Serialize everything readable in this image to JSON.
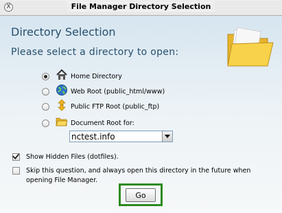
{
  "window": {
    "title": "File Manager Directory Selection",
    "close_glyph": "X"
  },
  "dialog": {
    "heading": "Directory Selection",
    "subheading": "Please select a directory to open:",
    "options": [
      {
        "label": "Home Directory",
        "icon": "house-icon",
        "selected": true
      },
      {
        "label": "Web Root (public_html/www)",
        "icon": "globe-icon",
        "selected": false
      },
      {
        "label": "Public FTP Root (public_ftp)",
        "icon": "ftp-arrows-icon",
        "selected": false
      },
      {
        "label": "Document Root for:",
        "icon": "folder-icon",
        "selected": false
      }
    ],
    "domain_select": {
      "value": "nctest.info"
    },
    "show_hidden": {
      "label": "Show Hidden Files (dotfiles).",
      "checked": true
    },
    "skip_question": {
      "label": "Skip this question, and always open this directory in the future when opening File Manager.",
      "checked": false
    },
    "go_label": "Go",
    "colors": {
      "accent_text": "#27506e",
      "go_highlight": "#2d8a1f"
    }
  }
}
